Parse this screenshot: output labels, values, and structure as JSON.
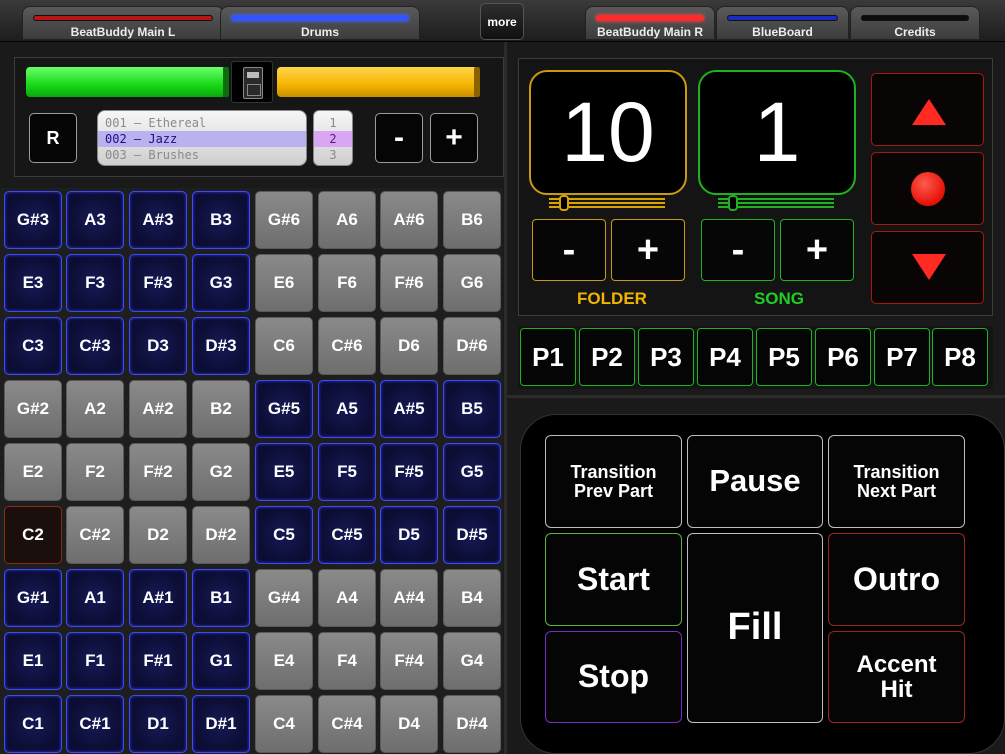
{
  "tabs": [
    {
      "label": "BeatBuddy Main L",
      "color": "#d11c1c",
      "active": false
    },
    {
      "label": "Drums",
      "color": "#2d4bff",
      "active": true
    },
    {
      "label": "BeatBuddy Main R",
      "color": "#ff2a2a",
      "active": true
    },
    {
      "label": "BlueBoard",
      "color": "#1a2ec8",
      "active": false
    },
    {
      "label": "Credits",
      "color": "#111111",
      "active": false
    }
  ],
  "more_label": "more",
  "controls": {
    "left_level": 0.97,
    "right_level": 0.98,
    "r_label": "R",
    "minus_label": "-",
    "plus_label": "+",
    "drumsets": [
      "001 – Ethereal",
      "002 – Jazz",
      "003 – Brushes"
    ],
    "drumset_selected_index": 1,
    "numbers": [
      "1",
      "2",
      "3"
    ],
    "number_selected_index": 1
  },
  "pads": [
    [
      "G#3",
      "A3",
      "A#3",
      "B3",
      "G#6",
      "A6",
      "A#6",
      "B6"
    ],
    [
      "E3",
      "F3",
      "F#3",
      "G3",
      "E6",
      "F6",
      "F#6",
      "G6"
    ],
    [
      "C3",
      "C#3",
      "D3",
      "D#3",
      "C6",
      "C#6",
      "D6",
      "D#6"
    ],
    [
      "G#2",
      "A2",
      "A#2",
      "B2",
      "G#5",
      "A5",
      "A#5",
      "B5"
    ],
    [
      "E2",
      "F2",
      "F#2",
      "G2",
      "E5",
      "F5",
      "F#5",
      "G5"
    ],
    [
      "C2",
      "C#2",
      "D2",
      "D#2",
      "C5",
      "C#5",
      "D5",
      "D#5"
    ],
    [
      "G#1",
      "A1",
      "A#1",
      "B1",
      "G#4",
      "A4",
      "A#4",
      "B4"
    ],
    [
      "E1",
      "F1",
      "F#1",
      "G1",
      "E4",
      "F4",
      "F#4",
      "G4"
    ],
    [
      "C1",
      "C#1",
      "D1",
      "D#1",
      "C4",
      "C#4",
      "D4",
      "D#4"
    ]
  ],
  "folder": {
    "value": "10",
    "label": "FOLDER",
    "minus": "-",
    "plus": "+",
    "color": "#f0b400"
  },
  "song": {
    "value": "1",
    "label": "SONG",
    "minus": "-",
    "plus": "+",
    "color": "#22cc22"
  },
  "presets": [
    "P1",
    "P2",
    "P3",
    "P4",
    "P5",
    "P6",
    "P7",
    "P8"
  ],
  "footswitch": {
    "transition_prev": "Transition Prev Part",
    "pause": "Pause",
    "transition_next": "Transition Next Part",
    "start": "Start",
    "fill": "Fill",
    "outro": "Outro",
    "stop": "Stop",
    "accent": "Accent Hit"
  }
}
